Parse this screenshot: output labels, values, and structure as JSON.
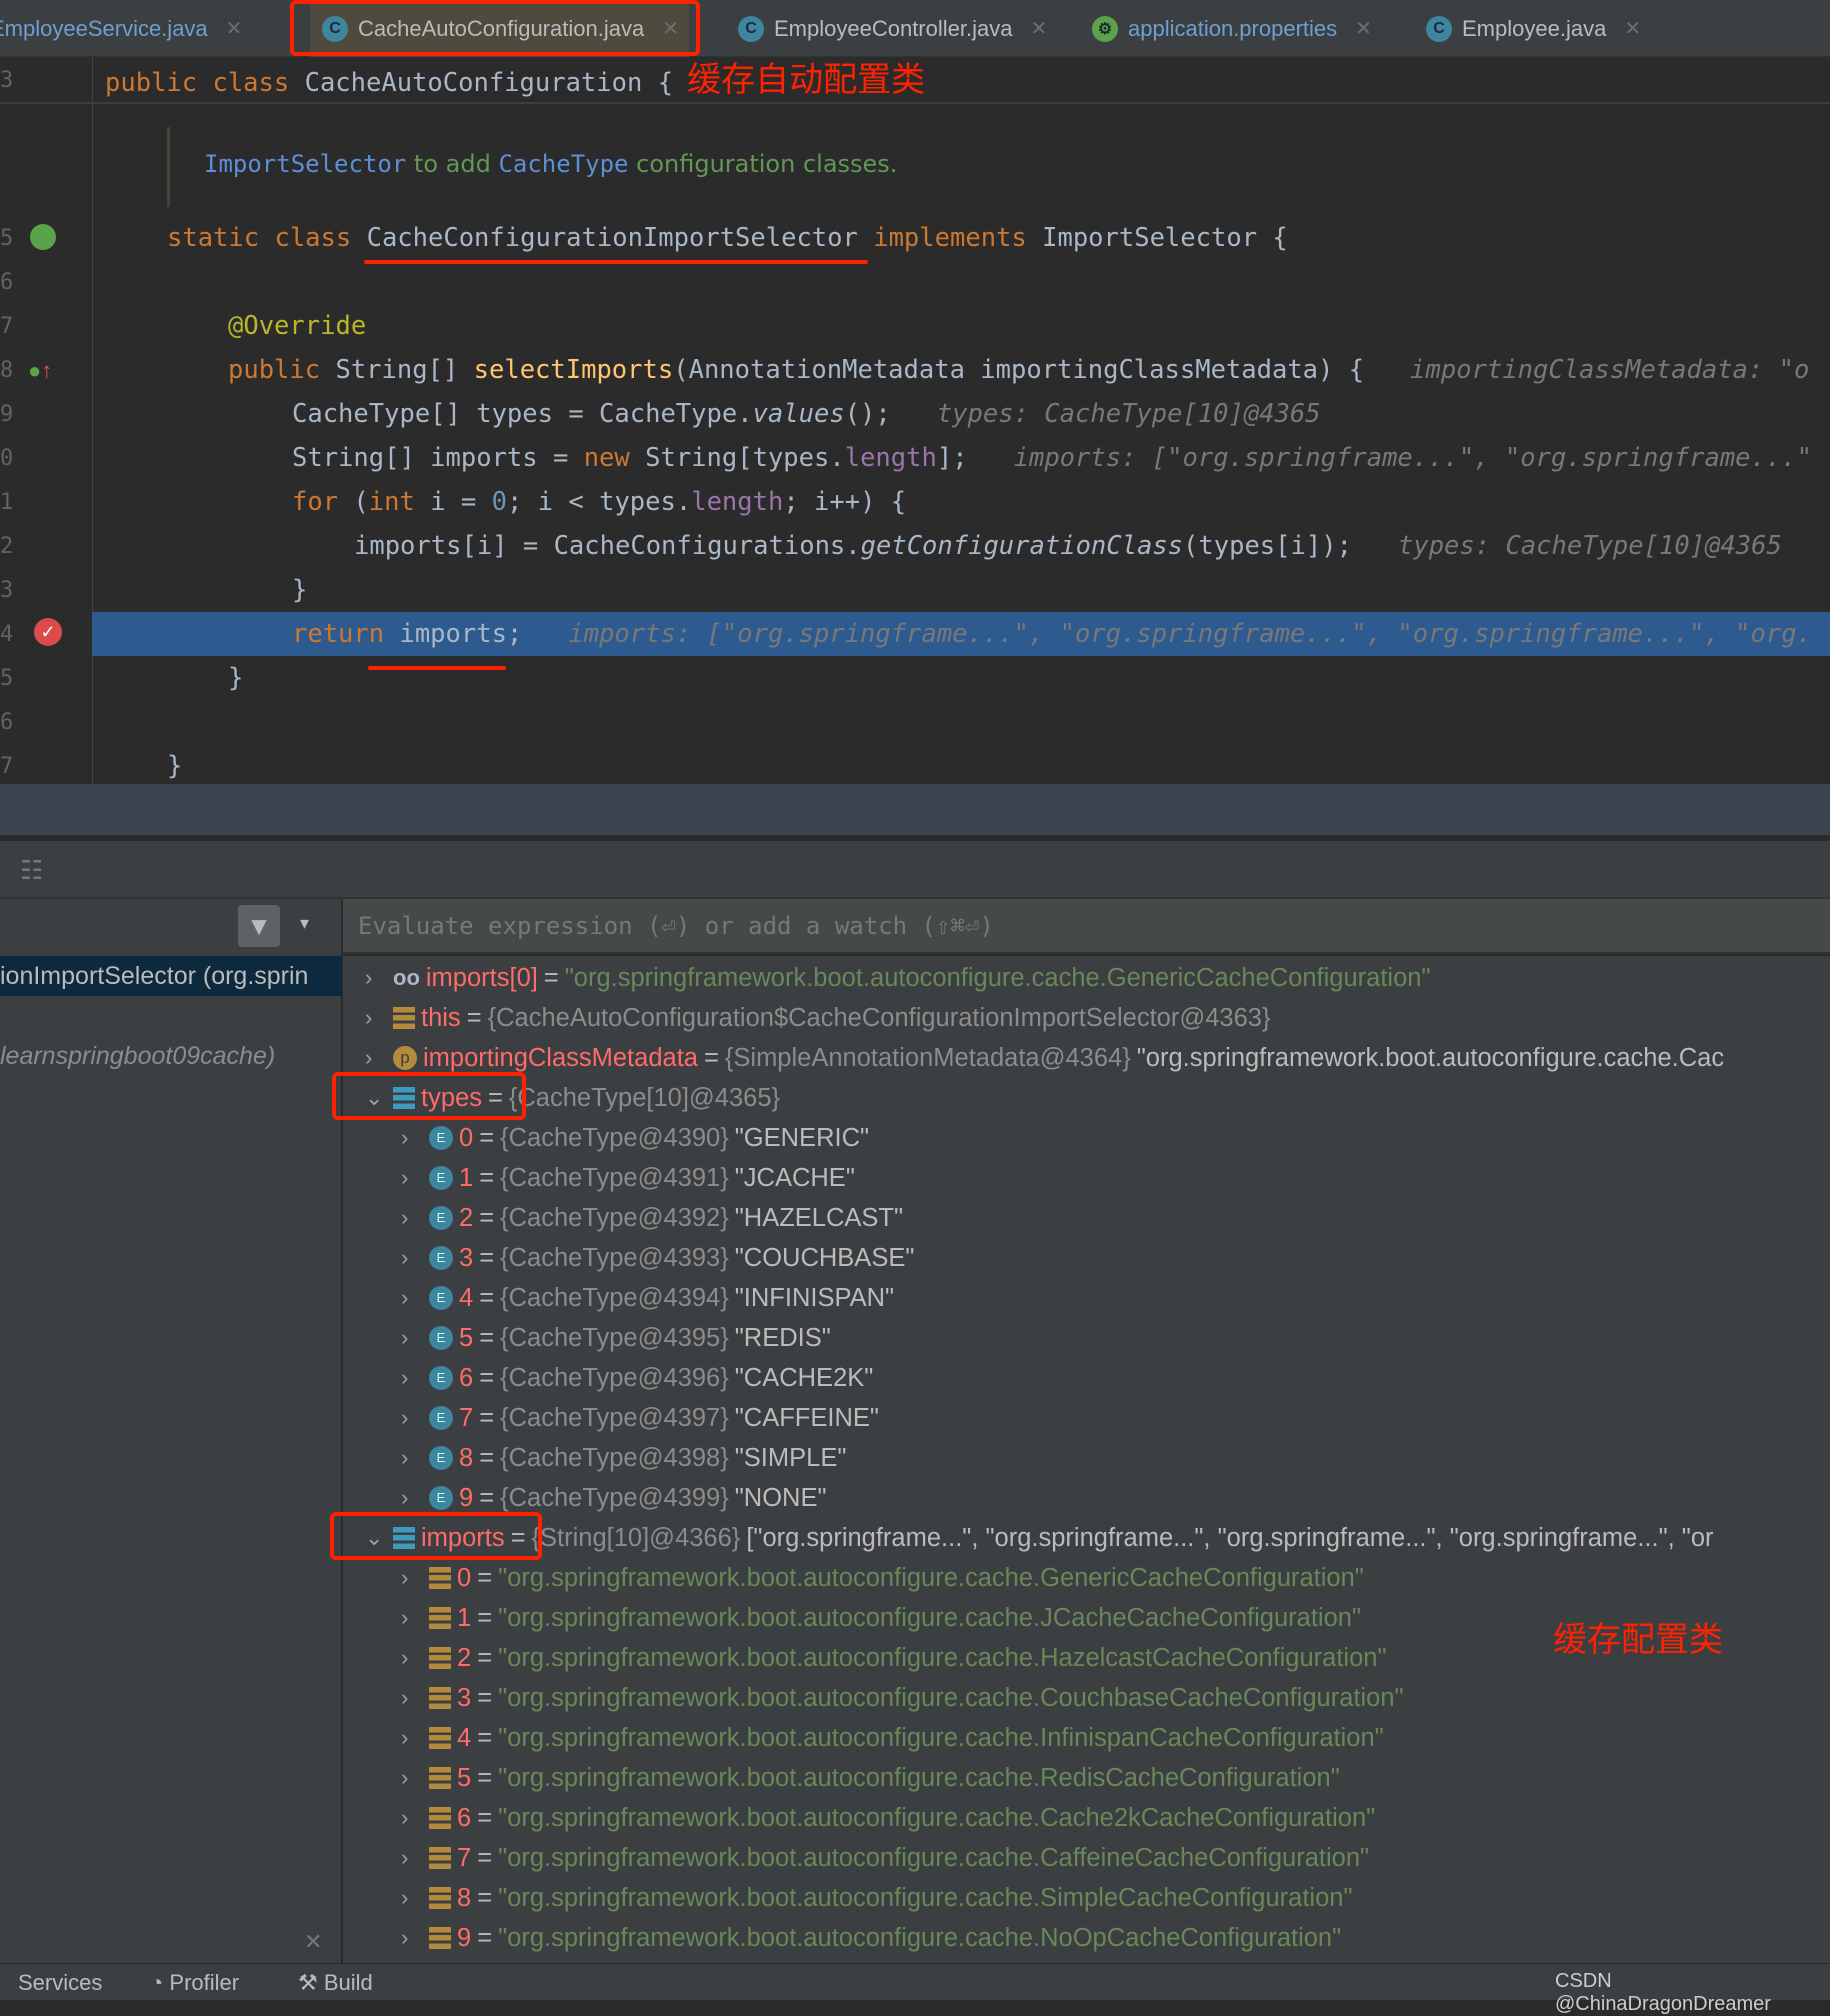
{
  "tabs": [
    {
      "label": "EmployeeService.java",
      "active": false
    },
    {
      "label": "CacheAutoConfiguration.java",
      "active": true
    },
    {
      "label": "EmployeeController.java",
      "active": false
    },
    {
      "label": "application.properties",
      "active": false
    },
    {
      "label": "Employee.java",
      "active": false
    }
  ],
  "editor": {
    "line_numbers": [
      "3",
      "5",
      "6",
      "7",
      "8",
      "9",
      "0",
      "1",
      "2",
      "3",
      "4",
      "5",
      "6",
      "7"
    ],
    "class_decl": {
      "kw": "public class ",
      "name": "CacheAutoConfiguration",
      "brace": " {"
    },
    "annotation_class": "缓存自动配置类",
    "doc": {
      "ref1": "ImportSelector",
      "t1": " to add ",
      "ref2": "CacheType",
      "t2": " configuration classes."
    },
    "lines": [
      [
        [
          "static class ",
          "kw"
        ],
        [
          "CacheConfigurationImportSelector",
          ""
        ],
        [
          " implements ",
          "kw"
        ],
        [
          "ImportSelector {",
          ""
        ]
      ],
      [],
      [
        [
          "@Override",
          "ann"
        ]
      ],
      [
        [
          "public ",
          "kw"
        ],
        [
          "String[] ",
          ""
        ],
        [
          "selectImports",
          "fn"
        ],
        [
          "(AnnotationMetadata importingClassMetadata) {   ",
          ""
        ],
        [
          "importingClassMetadata: \"o",
          "hint"
        ]
      ],
      [
        [
          "CacheType[] types = CacheType.",
          ""
        ],
        [
          "values",
          "it"
        ],
        [
          "();   ",
          ""
        ],
        [
          "types: CacheType[10]@4365",
          "hint"
        ]
      ],
      [
        [
          "String[] imports = ",
          ""
        ],
        [
          "new ",
          "kw"
        ],
        [
          "String[types.",
          ""
        ],
        [
          "length",
          "fld"
        ],
        [
          "];   ",
          ""
        ],
        [
          "imports: [\"org.springframe...\", \"org.springframe...\"",
          "hint"
        ]
      ],
      [
        [
          "for ",
          "kw"
        ],
        [
          "(",
          ""
        ],
        [
          "int ",
          "kw"
        ],
        [
          "i = ",
          ""
        ],
        [
          "0",
          "num"
        ],
        [
          "; i < types.",
          ""
        ],
        [
          "length",
          "fld"
        ],
        [
          "; i++) {",
          ""
        ]
      ],
      [
        [
          "imports[i] = CacheConfigurations.",
          ""
        ],
        [
          "getConfigurationClass",
          "it"
        ],
        [
          "(types[i]);   ",
          ""
        ],
        [
          "types: CacheType[10]@4365",
          "hint"
        ]
      ],
      [
        [
          "}",
          ""
        ]
      ],
      [
        [
          "return ",
          "kw"
        ],
        [
          "imports;   ",
          ""
        ],
        [
          "imports: [\"org.springframe...\", \"org.springframe...\", \"org.springframe...\", \"org.",
          "hint"
        ]
      ],
      [
        [
          "}",
          ""
        ]
      ],
      [],
      [
        [
          "}",
          ""
        ]
      ]
    ]
  },
  "debugger": {
    "evaluate_placeholder": "Evaluate expression (⏎) or add a watch (⇧⌘⏎)",
    "frames": [
      {
        "label": "ionImportSelector (org.sprin",
        "selected": true
      },
      {
        "label": "learnspringboot09cache)",
        "selected": false
      }
    ],
    "variables": [
      {
        "level": 0,
        "expanded": false,
        "icon": "watch-icon",
        "name": "imports[0]",
        "ref": "",
        "value": "\"org.springframework.boot.autoconfigure.cache.GenericCacheConfiguration\"",
        "vtype": "str"
      },
      {
        "level": 0,
        "expanded": false,
        "icon": "field-icon",
        "name": "this",
        "ref": "{CacheAutoConfiguration$CacheConfigurationImportSelector@4363}",
        "value": "",
        "vtype": "txt"
      },
      {
        "level": 0,
        "expanded": false,
        "icon": "parameter-icon",
        "name": "importingClassMetadata",
        "ref": "{SimpleAnnotationMetadata@4364}",
        "value": "\"org.springframework.boot.autoconfigure.cache.Cac",
        "vtype": "txt"
      },
      {
        "level": 0,
        "expanded": true,
        "icon": "array-icon",
        "name": "types",
        "ref": "{CacheType[10]@4365}",
        "value": "",
        "vtype": "txt"
      },
      {
        "level": 1,
        "expanded": false,
        "icon": "enum-icon",
        "name": "0",
        "ref": "{CacheType@4390}",
        "value": "\"GENERIC\"",
        "vtype": "txt"
      },
      {
        "level": 1,
        "expanded": false,
        "icon": "enum-icon",
        "name": "1",
        "ref": "{CacheType@4391}",
        "value": "\"JCACHE\"",
        "vtype": "txt"
      },
      {
        "level": 1,
        "expanded": false,
        "icon": "enum-icon",
        "name": "2",
        "ref": "{CacheType@4392}",
        "value": "\"HAZELCAST\"",
        "vtype": "txt"
      },
      {
        "level": 1,
        "expanded": false,
        "icon": "enum-icon",
        "name": "3",
        "ref": "{CacheType@4393}",
        "value": "\"COUCHBASE\"",
        "vtype": "txt"
      },
      {
        "level": 1,
        "expanded": false,
        "icon": "enum-icon",
        "name": "4",
        "ref": "{CacheType@4394}",
        "value": "\"INFINISPAN\"",
        "vtype": "txt"
      },
      {
        "level": 1,
        "expanded": false,
        "icon": "enum-icon",
        "name": "5",
        "ref": "{CacheType@4395}",
        "value": "\"REDIS\"",
        "vtype": "txt"
      },
      {
        "level": 1,
        "expanded": false,
        "icon": "enum-icon",
        "name": "6",
        "ref": "{CacheType@4396}",
        "value": "\"CACHE2K\"",
        "vtype": "txt"
      },
      {
        "level": 1,
        "expanded": false,
        "icon": "enum-icon",
        "name": "7",
        "ref": "{CacheType@4397}",
        "value": "\"CAFFEINE\"",
        "vtype": "txt"
      },
      {
        "level": 1,
        "expanded": false,
        "icon": "enum-icon",
        "name": "8",
        "ref": "{CacheType@4398}",
        "value": "\"SIMPLE\"",
        "vtype": "txt"
      },
      {
        "level": 1,
        "expanded": false,
        "icon": "enum-icon",
        "name": "9",
        "ref": "{CacheType@4399}",
        "value": "\"NONE\"",
        "vtype": "txt"
      },
      {
        "level": 0,
        "expanded": true,
        "icon": "array-icon",
        "name": "imports",
        "ref": "{String[10]@4366}",
        "value": "[\"org.springframe...\", \"org.springframe...\", \"org.springframe...\", \"org.springframe...\", \"or",
        "vtype": "txt"
      },
      {
        "level": 1,
        "expanded": false,
        "icon": "field-icon",
        "name": "0",
        "ref": "",
        "value": "\"org.springframework.boot.autoconfigure.cache.GenericCacheConfiguration\"",
        "vtype": "str"
      },
      {
        "level": 1,
        "expanded": false,
        "icon": "field-icon",
        "name": "1",
        "ref": "",
        "value": "\"org.springframework.boot.autoconfigure.cache.JCacheCacheConfiguration\"",
        "vtype": "str"
      },
      {
        "level": 1,
        "expanded": false,
        "icon": "field-icon",
        "name": "2",
        "ref": "",
        "value": "\"org.springframework.boot.autoconfigure.cache.HazelcastCacheConfiguration\"",
        "vtype": "str"
      },
      {
        "level": 1,
        "expanded": false,
        "icon": "field-icon",
        "name": "3",
        "ref": "",
        "value": "\"org.springframework.boot.autoconfigure.cache.CouchbaseCacheConfiguration\"",
        "vtype": "str"
      },
      {
        "level": 1,
        "expanded": false,
        "icon": "field-icon",
        "name": "4",
        "ref": "",
        "value": "\"org.springframework.boot.autoconfigure.cache.InfinispanCacheConfiguration\"",
        "vtype": "str"
      },
      {
        "level": 1,
        "expanded": false,
        "icon": "field-icon",
        "name": "5",
        "ref": "",
        "value": "\"org.springframework.boot.autoconfigure.cache.RedisCacheConfiguration\"",
        "vtype": "str"
      },
      {
        "level": 1,
        "expanded": false,
        "icon": "field-icon",
        "name": "6",
        "ref": "",
        "value": "\"org.springframework.boot.autoconfigure.cache.Cache2kCacheConfiguration\"",
        "vtype": "str"
      },
      {
        "level": 1,
        "expanded": false,
        "icon": "field-icon",
        "name": "7",
        "ref": "",
        "value": "\"org.springframework.boot.autoconfigure.cache.CaffeineCacheConfiguration\"",
        "vtype": "str"
      },
      {
        "level": 1,
        "expanded": false,
        "icon": "field-icon",
        "name": "8",
        "ref": "",
        "value": "\"org.springframework.boot.autoconfigure.cache.SimpleCacheConfiguration\"",
        "vtype": "str"
      },
      {
        "level": 1,
        "expanded": false,
        "icon": "field-icon",
        "name": "9",
        "ref": "",
        "value": "\"org.springframework.boot.autoconfigure.cache.NoOpCacheConfiguration\"",
        "vtype": "str"
      }
    ],
    "annotation_config": "缓存配置类"
  },
  "bottom": {
    "services": "Services",
    "profiler": "Profiler",
    "build": "Build",
    "watermark": "CSDN @ChinaDragonDreamer"
  },
  "colors": {
    "annotation_red": "#ff2200",
    "selection_blue": "#2d5a8f",
    "string_green": "#6a8759",
    "keyword_orange": "#cc7832",
    "var_name_red": "#ff6b68"
  }
}
